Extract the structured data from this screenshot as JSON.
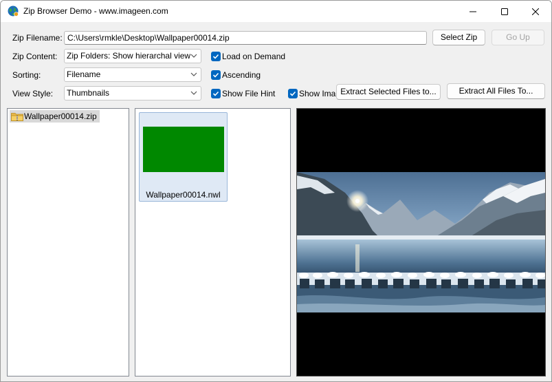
{
  "window": {
    "title": "Zip Browser Demo - www.imageen.com"
  },
  "form": {
    "zip_filename_label": "Zip Filename:",
    "zip_filename_value": "C:\\Users\\rmkle\\Desktop\\Wallpaper00014.zip",
    "zip_content_label": "Zip Content:",
    "zip_content_value": "Zip Folders: Show hierarchal view",
    "sorting_label": "Sorting:",
    "sorting_value": "Filename",
    "view_style_label": "View Style:",
    "view_style_value": "Thumbnails"
  },
  "buttons": {
    "select_zip": "Select Zip",
    "go_up": "Go Up",
    "extract_selected": "Extract Selected Files to...",
    "extract_all": "Extract All Files To..."
  },
  "checkboxes": {
    "load_on_demand": {
      "label": "Load on Demand",
      "checked": true
    },
    "ascending": {
      "label": "Ascending",
      "checked": true
    },
    "show_file_hint": {
      "label": "Show File Hint",
      "checked": true
    },
    "show_image": {
      "label": "Show Imag",
      "checked": true
    }
  },
  "tree": {
    "items": [
      {
        "label": "Wallpaper00014.zip",
        "selected": true
      }
    ]
  },
  "files": {
    "items": [
      {
        "caption": "Wallpaper00014.nwl",
        "selected": true
      }
    ]
  },
  "colors": {
    "accent": "#0067c0",
    "thumbnail_fill": "#008800",
    "preview_background": "#000000"
  },
  "icons": {
    "app": "globe-icon",
    "folder": "zip-folder-icon",
    "dropdown": "chevron-down-icon",
    "check": "checkmark-icon",
    "minimize": "minimize-icon",
    "maximize": "maximize-icon",
    "close": "close-icon"
  }
}
